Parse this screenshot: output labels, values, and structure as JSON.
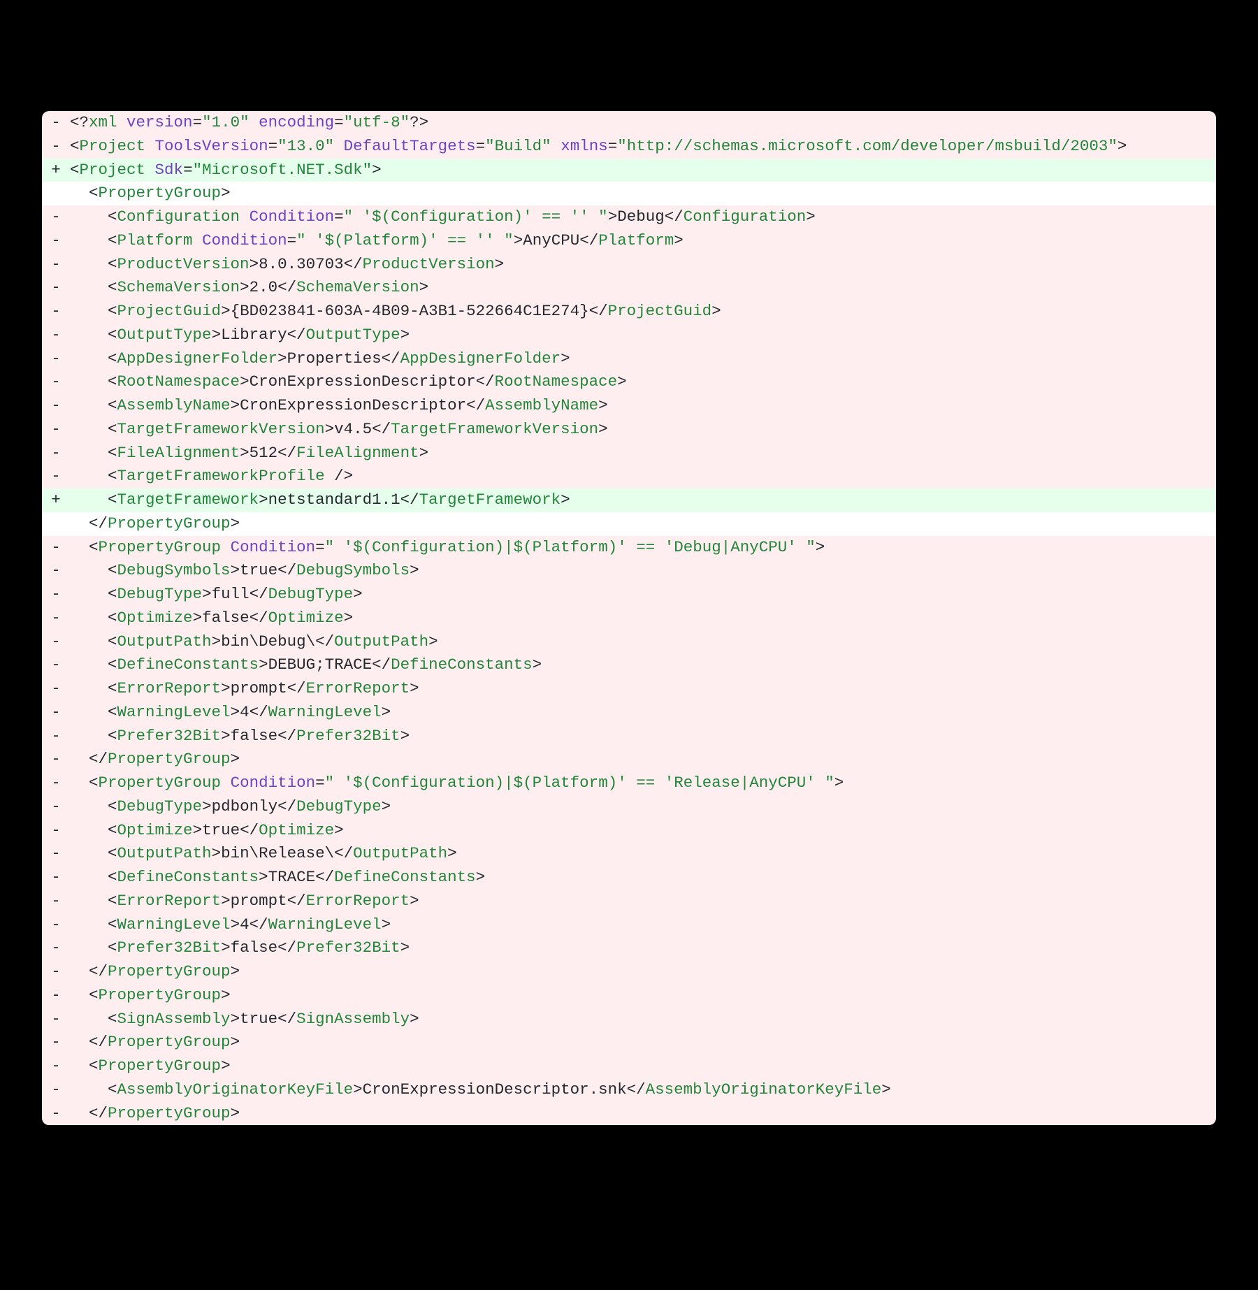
{
  "colors": {
    "removed_bg": "#ffeef0",
    "added_bg": "#e6ffed",
    "context_bg": "#ffffff",
    "tag": "#22863a",
    "attr": "#6f42c1"
  },
  "lines": [
    {
      "type": "removed",
      "indent": 0,
      "tokens": [
        {
          "t": "plain",
          "v": "<?"
        },
        {
          "t": "tag",
          "v": "xml"
        },
        {
          "t": "plain",
          "v": " "
        },
        {
          "t": "attr",
          "v": "version"
        },
        {
          "t": "plain",
          "v": "="
        },
        {
          "t": "tag",
          "v": "\"1.0\""
        },
        {
          "t": "plain",
          "v": " "
        },
        {
          "t": "attr",
          "v": "encoding"
        },
        {
          "t": "plain",
          "v": "="
        },
        {
          "t": "tag",
          "v": "\"utf-8\""
        },
        {
          "t": "plain",
          "v": "?>"
        }
      ]
    },
    {
      "type": "removed",
      "indent": 0,
      "tokens": [
        {
          "t": "plain",
          "v": "<"
        },
        {
          "t": "tag",
          "v": "Project"
        },
        {
          "t": "plain",
          "v": " "
        },
        {
          "t": "attr",
          "v": "ToolsVersion"
        },
        {
          "t": "plain",
          "v": "="
        },
        {
          "t": "tag",
          "v": "\"13.0\""
        },
        {
          "t": "plain",
          "v": " "
        },
        {
          "t": "attr",
          "v": "DefaultTargets"
        },
        {
          "t": "plain",
          "v": "="
        },
        {
          "t": "tag",
          "v": "\"Build\""
        },
        {
          "t": "plain",
          "v": " "
        },
        {
          "t": "attr",
          "v": "xmlns"
        },
        {
          "t": "plain",
          "v": "="
        },
        {
          "t": "tag",
          "v": "\"http://schemas.microsoft.com/developer/msbuild/2003\""
        },
        {
          "t": "plain",
          "v": ">"
        }
      ]
    },
    {
      "type": "added",
      "indent": 0,
      "tokens": [
        {
          "t": "plain",
          "v": "<"
        },
        {
          "t": "tag",
          "v": "Project"
        },
        {
          "t": "plain",
          "v": " "
        },
        {
          "t": "attr",
          "v": "Sdk"
        },
        {
          "t": "plain",
          "v": "="
        },
        {
          "t": "tag",
          "v": "\"Microsoft.NET.Sdk\""
        },
        {
          "t": "plain",
          "v": ">"
        }
      ]
    },
    {
      "type": "context",
      "indent": 1,
      "tokens": [
        {
          "t": "plain",
          "v": "<"
        },
        {
          "t": "tag",
          "v": "PropertyGroup"
        },
        {
          "t": "plain",
          "v": ">"
        }
      ]
    },
    {
      "type": "removed",
      "indent": 2,
      "tokens": [
        {
          "t": "plain",
          "v": "<"
        },
        {
          "t": "tag",
          "v": "Configuration"
        },
        {
          "t": "plain",
          "v": " "
        },
        {
          "t": "attr",
          "v": "Condition"
        },
        {
          "t": "plain",
          "v": "="
        },
        {
          "t": "tag",
          "v": "\" '$(Configuration)' == '' \""
        },
        {
          "t": "plain",
          "v": ">Debug</"
        },
        {
          "t": "tag",
          "v": "Configuration"
        },
        {
          "t": "plain",
          "v": ">"
        }
      ]
    },
    {
      "type": "removed",
      "indent": 2,
      "tokens": [
        {
          "t": "plain",
          "v": "<"
        },
        {
          "t": "tag",
          "v": "Platform"
        },
        {
          "t": "plain",
          "v": " "
        },
        {
          "t": "attr",
          "v": "Condition"
        },
        {
          "t": "plain",
          "v": "="
        },
        {
          "t": "tag",
          "v": "\" '$(Platform)' == '' \""
        },
        {
          "t": "plain",
          "v": ">AnyCPU</"
        },
        {
          "t": "tag",
          "v": "Platform"
        },
        {
          "t": "plain",
          "v": ">"
        }
      ]
    },
    {
      "type": "removed",
      "indent": 2,
      "tokens": [
        {
          "t": "plain",
          "v": "<"
        },
        {
          "t": "tag",
          "v": "ProductVersion"
        },
        {
          "t": "plain",
          "v": ">8.0.30703</"
        },
        {
          "t": "tag",
          "v": "ProductVersion"
        },
        {
          "t": "plain",
          "v": ">"
        }
      ]
    },
    {
      "type": "removed",
      "indent": 2,
      "tokens": [
        {
          "t": "plain",
          "v": "<"
        },
        {
          "t": "tag",
          "v": "SchemaVersion"
        },
        {
          "t": "plain",
          "v": ">2.0</"
        },
        {
          "t": "tag",
          "v": "SchemaVersion"
        },
        {
          "t": "plain",
          "v": ">"
        }
      ]
    },
    {
      "type": "removed",
      "indent": 2,
      "tokens": [
        {
          "t": "plain",
          "v": "<"
        },
        {
          "t": "tag",
          "v": "ProjectGuid"
        },
        {
          "t": "plain",
          "v": ">{BD023841-603A-4B09-A3B1-522664C1E274}</"
        },
        {
          "t": "tag",
          "v": "ProjectGuid"
        },
        {
          "t": "plain",
          "v": ">"
        }
      ]
    },
    {
      "type": "removed",
      "indent": 2,
      "tokens": [
        {
          "t": "plain",
          "v": "<"
        },
        {
          "t": "tag",
          "v": "OutputType"
        },
        {
          "t": "plain",
          "v": ">Library</"
        },
        {
          "t": "tag",
          "v": "OutputType"
        },
        {
          "t": "plain",
          "v": ">"
        }
      ]
    },
    {
      "type": "removed",
      "indent": 2,
      "tokens": [
        {
          "t": "plain",
          "v": "<"
        },
        {
          "t": "tag",
          "v": "AppDesignerFolder"
        },
        {
          "t": "plain",
          "v": ">Properties</"
        },
        {
          "t": "tag",
          "v": "AppDesignerFolder"
        },
        {
          "t": "plain",
          "v": ">"
        }
      ]
    },
    {
      "type": "removed",
      "indent": 2,
      "tokens": [
        {
          "t": "plain",
          "v": "<"
        },
        {
          "t": "tag",
          "v": "RootNamespace"
        },
        {
          "t": "plain",
          "v": ">CronExpressionDescriptor</"
        },
        {
          "t": "tag",
          "v": "RootNamespace"
        },
        {
          "t": "plain",
          "v": ">"
        }
      ]
    },
    {
      "type": "removed",
      "indent": 2,
      "tokens": [
        {
          "t": "plain",
          "v": "<"
        },
        {
          "t": "tag",
          "v": "AssemblyName"
        },
        {
          "t": "plain",
          "v": ">CronExpressionDescriptor</"
        },
        {
          "t": "tag",
          "v": "AssemblyName"
        },
        {
          "t": "plain",
          "v": ">"
        }
      ]
    },
    {
      "type": "removed",
      "indent": 2,
      "tokens": [
        {
          "t": "plain",
          "v": "<"
        },
        {
          "t": "tag",
          "v": "TargetFrameworkVersion"
        },
        {
          "t": "plain",
          "v": ">v4.5</"
        },
        {
          "t": "tag",
          "v": "TargetFrameworkVersion"
        },
        {
          "t": "plain",
          "v": ">"
        }
      ]
    },
    {
      "type": "removed",
      "indent": 2,
      "tokens": [
        {
          "t": "plain",
          "v": "<"
        },
        {
          "t": "tag",
          "v": "FileAlignment"
        },
        {
          "t": "plain",
          "v": ">512</"
        },
        {
          "t": "tag",
          "v": "FileAlignment"
        },
        {
          "t": "plain",
          "v": ">"
        }
      ]
    },
    {
      "type": "removed",
      "indent": 2,
      "tokens": [
        {
          "t": "plain",
          "v": "<"
        },
        {
          "t": "tag",
          "v": "TargetFrameworkProfile"
        },
        {
          "t": "plain",
          "v": " />"
        }
      ]
    },
    {
      "type": "added",
      "indent": 2,
      "tokens": [
        {
          "t": "plain",
          "v": "<"
        },
        {
          "t": "tag",
          "v": "TargetFramework"
        },
        {
          "t": "plain",
          "v": ">netstandard1.1</"
        },
        {
          "t": "tag",
          "v": "TargetFramework"
        },
        {
          "t": "plain",
          "v": ">"
        }
      ]
    },
    {
      "type": "context",
      "indent": 1,
      "tokens": [
        {
          "t": "plain",
          "v": "</"
        },
        {
          "t": "tag",
          "v": "PropertyGroup"
        },
        {
          "t": "plain",
          "v": ">"
        }
      ]
    },
    {
      "type": "removed",
      "indent": 1,
      "tokens": [
        {
          "t": "plain",
          "v": "<"
        },
        {
          "t": "tag",
          "v": "PropertyGroup"
        },
        {
          "t": "plain",
          "v": " "
        },
        {
          "t": "attr",
          "v": "Condition"
        },
        {
          "t": "plain",
          "v": "="
        },
        {
          "t": "tag",
          "v": "\" '$(Configuration)|$(Platform)' == 'Debug|AnyCPU' \""
        },
        {
          "t": "plain",
          "v": ">"
        }
      ]
    },
    {
      "type": "removed",
      "indent": 2,
      "tokens": [
        {
          "t": "plain",
          "v": "<"
        },
        {
          "t": "tag",
          "v": "DebugSymbols"
        },
        {
          "t": "plain",
          "v": ">true</"
        },
        {
          "t": "tag",
          "v": "DebugSymbols"
        },
        {
          "t": "plain",
          "v": ">"
        }
      ]
    },
    {
      "type": "removed",
      "indent": 2,
      "tokens": [
        {
          "t": "plain",
          "v": "<"
        },
        {
          "t": "tag",
          "v": "DebugType"
        },
        {
          "t": "plain",
          "v": ">full</"
        },
        {
          "t": "tag",
          "v": "DebugType"
        },
        {
          "t": "plain",
          "v": ">"
        }
      ]
    },
    {
      "type": "removed",
      "indent": 2,
      "tokens": [
        {
          "t": "plain",
          "v": "<"
        },
        {
          "t": "tag",
          "v": "Optimize"
        },
        {
          "t": "plain",
          "v": ">false</"
        },
        {
          "t": "tag",
          "v": "Optimize"
        },
        {
          "t": "plain",
          "v": ">"
        }
      ]
    },
    {
      "type": "removed",
      "indent": 2,
      "tokens": [
        {
          "t": "plain",
          "v": "<"
        },
        {
          "t": "tag",
          "v": "OutputPath"
        },
        {
          "t": "plain",
          "v": ">bin\\Debug\\</"
        },
        {
          "t": "tag",
          "v": "OutputPath"
        },
        {
          "t": "plain",
          "v": ">"
        }
      ]
    },
    {
      "type": "removed",
      "indent": 2,
      "tokens": [
        {
          "t": "plain",
          "v": "<"
        },
        {
          "t": "tag",
          "v": "DefineConstants"
        },
        {
          "t": "plain",
          "v": ">DEBUG;TRACE</"
        },
        {
          "t": "tag",
          "v": "DefineConstants"
        },
        {
          "t": "plain",
          "v": ">"
        }
      ]
    },
    {
      "type": "removed",
      "indent": 2,
      "tokens": [
        {
          "t": "plain",
          "v": "<"
        },
        {
          "t": "tag",
          "v": "ErrorReport"
        },
        {
          "t": "plain",
          "v": ">prompt</"
        },
        {
          "t": "tag",
          "v": "ErrorReport"
        },
        {
          "t": "plain",
          "v": ">"
        }
      ]
    },
    {
      "type": "removed",
      "indent": 2,
      "tokens": [
        {
          "t": "plain",
          "v": "<"
        },
        {
          "t": "tag",
          "v": "WarningLevel"
        },
        {
          "t": "plain",
          "v": ">4</"
        },
        {
          "t": "tag",
          "v": "WarningLevel"
        },
        {
          "t": "plain",
          "v": ">"
        }
      ]
    },
    {
      "type": "removed",
      "indent": 2,
      "tokens": [
        {
          "t": "plain",
          "v": "<"
        },
        {
          "t": "tag",
          "v": "Prefer32Bit"
        },
        {
          "t": "plain",
          "v": ">false</"
        },
        {
          "t": "tag",
          "v": "Prefer32Bit"
        },
        {
          "t": "plain",
          "v": ">"
        }
      ]
    },
    {
      "type": "removed",
      "indent": 1,
      "tokens": [
        {
          "t": "plain",
          "v": "</"
        },
        {
          "t": "tag",
          "v": "PropertyGroup"
        },
        {
          "t": "plain",
          "v": ">"
        }
      ]
    },
    {
      "type": "removed",
      "indent": 1,
      "tokens": [
        {
          "t": "plain",
          "v": "<"
        },
        {
          "t": "tag",
          "v": "PropertyGroup"
        },
        {
          "t": "plain",
          "v": " "
        },
        {
          "t": "attr",
          "v": "Condition"
        },
        {
          "t": "plain",
          "v": "="
        },
        {
          "t": "tag",
          "v": "\" '$(Configuration)|$(Platform)' == 'Release|AnyCPU' \""
        },
        {
          "t": "plain",
          "v": ">"
        }
      ]
    },
    {
      "type": "removed",
      "indent": 2,
      "tokens": [
        {
          "t": "plain",
          "v": "<"
        },
        {
          "t": "tag",
          "v": "DebugType"
        },
        {
          "t": "plain",
          "v": ">pdbonly</"
        },
        {
          "t": "tag",
          "v": "DebugType"
        },
        {
          "t": "plain",
          "v": ">"
        }
      ]
    },
    {
      "type": "removed",
      "indent": 2,
      "tokens": [
        {
          "t": "plain",
          "v": "<"
        },
        {
          "t": "tag",
          "v": "Optimize"
        },
        {
          "t": "plain",
          "v": ">true</"
        },
        {
          "t": "tag",
          "v": "Optimize"
        },
        {
          "t": "plain",
          "v": ">"
        }
      ]
    },
    {
      "type": "removed",
      "indent": 2,
      "tokens": [
        {
          "t": "plain",
          "v": "<"
        },
        {
          "t": "tag",
          "v": "OutputPath"
        },
        {
          "t": "plain",
          "v": ">bin\\Release\\</"
        },
        {
          "t": "tag",
          "v": "OutputPath"
        },
        {
          "t": "plain",
          "v": ">"
        }
      ]
    },
    {
      "type": "removed",
      "indent": 2,
      "tokens": [
        {
          "t": "plain",
          "v": "<"
        },
        {
          "t": "tag",
          "v": "DefineConstants"
        },
        {
          "t": "plain",
          "v": ">TRACE</"
        },
        {
          "t": "tag",
          "v": "DefineConstants"
        },
        {
          "t": "plain",
          "v": ">"
        }
      ]
    },
    {
      "type": "removed",
      "indent": 2,
      "tokens": [
        {
          "t": "plain",
          "v": "<"
        },
        {
          "t": "tag",
          "v": "ErrorReport"
        },
        {
          "t": "plain",
          "v": ">prompt</"
        },
        {
          "t": "tag",
          "v": "ErrorReport"
        },
        {
          "t": "plain",
          "v": ">"
        }
      ]
    },
    {
      "type": "removed",
      "indent": 2,
      "tokens": [
        {
          "t": "plain",
          "v": "<"
        },
        {
          "t": "tag",
          "v": "WarningLevel"
        },
        {
          "t": "plain",
          "v": ">4</"
        },
        {
          "t": "tag",
          "v": "WarningLevel"
        },
        {
          "t": "plain",
          "v": ">"
        }
      ]
    },
    {
      "type": "removed",
      "indent": 2,
      "tokens": [
        {
          "t": "plain",
          "v": "<"
        },
        {
          "t": "tag",
          "v": "Prefer32Bit"
        },
        {
          "t": "plain",
          "v": ">false</"
        },
        {
          "t": "tag",
          "v": "Prefer32Bit"
        },
        {
          "t": "plain",
          "v": ">"
        }
      ]
    },
    {
      "type": "removed",
      "indent": 1,
      "tokens": [
        {
          "t": "plain",
          "v": "</"
        },
        {
          "t": "tag",
          "v": "PropertyGroup"
        },
        {
          "t": "plain",
          "v": ">"
        }
      ]
    },
    {
      "type": "removed",
      "indent": 1,
      "tokens": [
        {
          "t": "plain",
          "v": "<"
        },
        {
          "t": "tag",
          "v": "PropertyGroup"
        },
        {
          "t": "plain",
          "v": ">"
        }
      ]
    },
    {
      "type": "removed",
      "indent": 2,
      "tokens": [
        {
          "t": "plain",
          "v": "<"
        },
        {
          "t": "tag",
          "v": "SignAssembly"
        },
        {
          "t": "plain",
          "v": ">true</"
        },
        {
          "t": "tag",
          "v": "SignAssembly"
        },
        {
          "t": "plain",
          "v": ">"
        }
      ]
    },
    {
      "type": "removed",
      "indent": 1,
      "tokens": [
        {
          "t": "plain",
          "v": "</"
        },
        {
          "t": "tag",
          "v": "PropertyGroup"
        },
        {
          "t": "plain",
          "v": ">"
        }
      ]
    },
    {
      "type": "removed",
      "indent": 1,
      "tokens": [
        {
          "t": "plain",
          "v": "<"
        },
        {
          "t": "tag",
          "v": "PropertyGroup"
        },
        {
          "t": "plain",
          "v": ">"
        }
      ]
    },
    {
      "type": "removed",
      "indent": 2,
      "tokens": [
        {
          "t": "plain",
          "v": "<"
        },
        {
          "t": "tag",
          "v": "AssemblyOriginatorKeyFile"
        },
        {
          "t": "plain",
          "v": ">CronExpressionDescriptor.snk</"
        },
        {
          "t": "tag",
          "v": "AssemblyOriginatorKeyFile"
        },
        {
          "t": "plain",
          "v": ">"
        }
      ]
    },
    {
      "type": "removed",
      "indent": 1,
      "tokens": [
        {
          "t": "plain",
          "v": "</"
        },
        {
          "t": "tag",
          "v": "PropertyGroup"
        },
        {
          "t": "plain",
          "v": ">"
        }
      ]
    }
  ],
  "gutter_symbols": {
    "removed": "-",
    "added": "+",
    "context": " "
  }
}
